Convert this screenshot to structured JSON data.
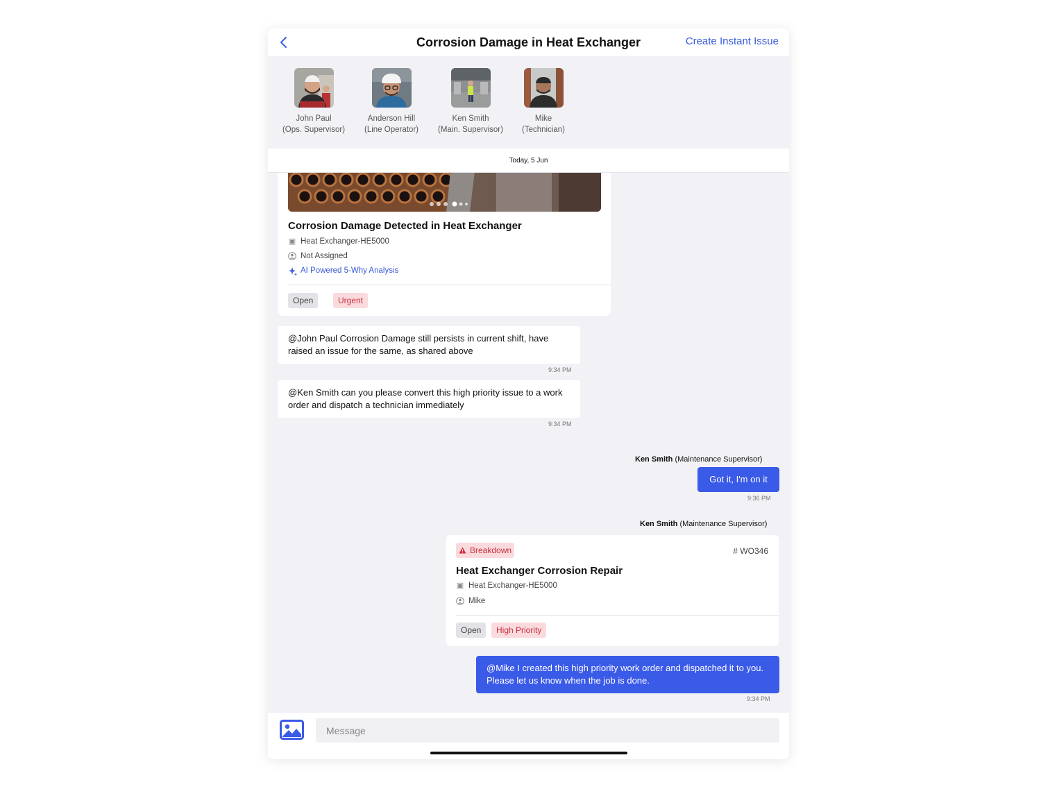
{
  "header": {
    "title": "Corrosion Damage in Heat Exchanger",
    "create_label": "Create Instant Issue"
  },
  "participants": [
    {
      "name": "John Paul",
      "role": "(Ops. Supervisor)"
    },
    {
      "name": "Anderson Hill",
      "role": "(Line Operator)"
    },
    {
      "name": "Ken Smith",
      "role": "(Main. Supervisor)"
    },
    {
      "name": "Mike",
      "role": "(Technician)"
    }
  ],
  "date_label": "Today, 5 Jun",
  "issue_card": {
    "title": "Corrosion Damage Detected in Heat Exchanger",
    "asset": "Heat Exchanger-HE5000",
    "assignee": "Not Assigned",
    "ai_link": "AI Powered 5-Why Analysis",
    "status": "Open",
    "priority": "Urgent"
  },
  "messages": [
    {
      "text": "@John Paul Corrosion Damage still persists in current shift, have raised an issue for the same, as shared above",
      "time": "9:34 PM"
    },
    {
      "text": "@Ken Smith can you please convert this high priority issue to a work order and dispatch a technician immediately",
      "time": "9:34 PM"
    },
    {
      "sender_name": "Ken Smith",
      "sender_role": "(Maintenance Supervisor)",
      "text": "Got it, I'm on it",
      "time": "9:36 PM"
    },
    {
      "sender_name": "Ken Smith",
      "sender_role": "(Maintenance Supervisor)"
    },
    {
      "text": "@Mike I created this high priority work order and dispatched it to you. Please let us know when the job is done.",
      "time": "9:34 PM"
    }
  ],
  "work_order": {
    "type": "Breakdown",
    "number": "# WO346",
    "title": "Heat Exchanger Corrosion Repair",
    "asset": "Heat Exchanger-HE5000",
    "assignee": "Mike",
    "status": "Open",
    "priority": "High Priority"
  },
  "composer": {
    "placeholder": "Message"
  },
  "colors": {
    "accent": "#3a5ae8",
    "link": "#3a5bdc",
    "urgent_bg": "#fadadd",
    "urgent_text": "#c9323f"
  }
}
